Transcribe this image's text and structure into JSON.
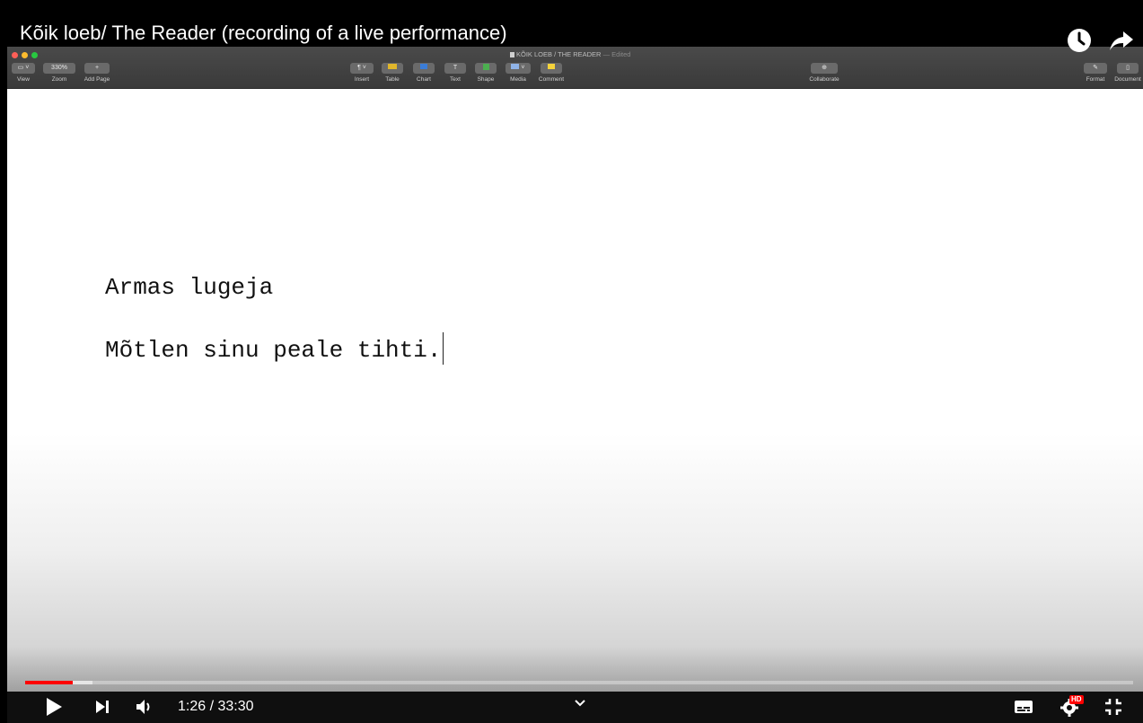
{
  "video": {
    "title": "Kõik loeb/ The Reader (recording of a live performance)",
    "current_time": "1:26",
    "separator": " / ",
    "duration": "33:30",
    "progress_fraction": 0.043,
    "buffered_fraction": 0.061,
    "hd_badge": "HD"
  },
  "pages_app": {
    "document_name": "KÕIK LOEB / THE READER",
    "document_status": "— Edited",
    "zoom_value": "330%",
    "toolbar": {
      "view": "View",
      "zoom": "Zoom",
      "add_page": "Add Page",
      "insert": "Insert",
      "table": "Table",
      "chart": "Chart",
      "text": "Text",
      "shape": "Shape",
      "media": "Media",
      "comment": "Comment",
      "collaborate": "Collaborate",
      "format": "Format",
      "document": "Document"
    }
  },
  "document": {
    "lines": [
      "Armas lugeja",
      "Mõtlen sinu peale tihti."
    ]
  },
  "colors": {
    "progress_played": "#ff0000",
    "hd_badge": "#ff0000",
    "toolbar_bg": "#3f3f3f",
    "table_icon": "#e0b62b",
    "shape_icon": "#4caf50",
    "comment_icon": "#f5d33b",
    "chart_icon": "#3b7dd8"
  },
  "icons": {
    "watch_later": "clock-icon",
    "share": "share-arrow-icon",
    "play": "play-icon",
    "next": "next-icon",
    "volume": "volume-icon",
    "chevron": "chevron-down-icon",
    "subtitles": "subtitles-icon",
    "settings": "gear-icon",
    "exit_fullscreen": "exit-fullscreen-icon"
  }
}
